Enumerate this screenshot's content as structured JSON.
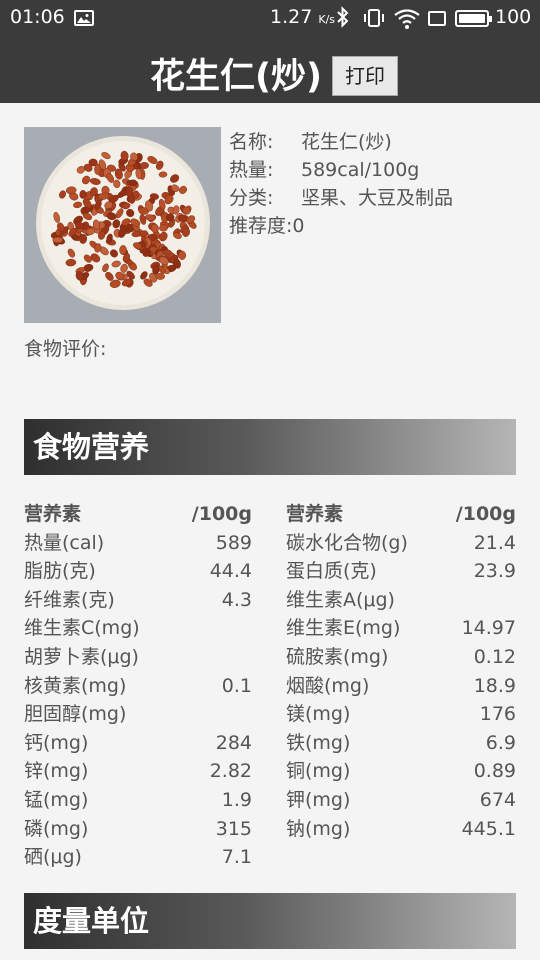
{
  "status_bar": {
    "time": "01:06",
    "network_speed": "1.27",
    "network_speed_unit": "K/s",
    "battery": "100"
  },
  "header": {
    "title": "花生仁(炒)",
    "print_label": "打印"
  },
  "food": {
    "image_icon": "peanuts-plate-image",
    "name_key": "名称:",
    "name": "花生仁(炒)",
    "calories_key": "热量:",
    "calories": "589cal/100g",
    "category_key": "分类:",
    "category": "坚果、大豆及制品",
    "recommend_key": "推荐度:",
    "recommend": "0",
    "evaluation_label": "食物评价:"
  },
  "nutrition": {
    "section_title": "食物营养",
    "left": {
      "header_name": "营养素",
      "header_unit": "/100g",
      "rows": [
        {
          "name": "热量(cal)",
          "value": "589"
        },
        {
          "name": "脂肪(克)",
          "value": "44.4"
        },
        {
          "name": "纤维素(克)",
          "value": "4.3"
        },
        {
          "name": "维生素C(mg)",
          "value": ""
        },
        {
          "name": "胡萝卜素(μg)",
          "value": ""
        },
        {
          "name": "核黄素(mg)",
          "value": "0.1"
        },
        {
          "name": "胆固醇(mg)",
          "value": ""
        },
        {
          "name": "钙(mg)",
          "value": "284"
        },
        {
          "name": "锌(mg)",
          "value": "2.82"
        },
        {
          "name": "锰(mg)",
          "value": "1.9"
        },
        {
          "name": "磷(mg)",
          "value": "315"
        },
        {
          "name": "硒(μg)",
          "value": "7.1"
        }
      ]
    },
    "right": {
      "header_name": "营养素",
      "header_unit": "/100g",
      "rows": [
        {
          "name": "碳水化合物(g)",
          "value": "21.4"
        },
        {
          "name": "蛋白质(克)",
          "value": "23.9"
        },
        {
          "name": "维生素A(μg)",
          "value": ""
        },
        {
          "name": "维生素E(mg)",
          "value": "14.97"
        },
        {
          "name": "硫胺素(mg)",
          "value": "0.12"
        },
        {
          "name": "烟酸(mg)",
          "value": "18.9"
        },
        {
          "name": "镁(mg)",
          "value": "176"
        },
        {
          "name": "铁(mg)",
          "value": "6.9"
        },
        {
          "name": "铜(mg)",
          "value": "0.89"
        },
        {
          "name": "钾(mg)",
          "value": "674"
        },
        {
          "name": "钠(mg)",
          "value": "445.1"
        }
      ]
    }
  },
  "measure": {
    "section_title": "度量单位"
  }
}
